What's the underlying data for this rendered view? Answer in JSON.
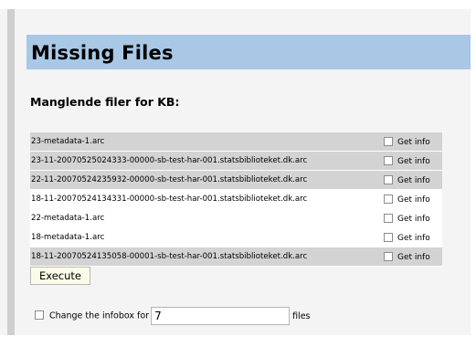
{
  "page": {
    "title": "Missing Files",
    "subtitle": "Manglende filer for KB:"
  },
  "files": [
    {
      "name": "23-metadata-1.arc",
      "option_label": "Get info",
      "row_shade": "dark"
    },
    {
      "name": "23-11-20070525024333-00000-sb-test-har-001.statsbiblioteket.dk.arc",
      "option_label": "Get info",
      "row_shade": "dark"
    },
    {
      "name": "22-11-20070524235932-00000-sb-test-har-001.statsbiblioteket.dk.arc",
      "option_label": "Get info",
      "row_shade": "dark"
    },
    {
      "name": "18-11-20070524134331-00000-sb-test-har-001.statsbiblioteket.dk.arc",
      "option_label": "Get info",
      "row_shade": "light"
    },
    {
      "name": "22-metadata-1.arc",
      "option_label": "Get info",
      "row_shade": "light"
    },
    {
      "name": "18-metadata-1.arc",
      "option_label": "Get info",
      "row_shade": "light"
    },
    {
      "name": "18-11-20070524135058-00001-sb-test-har-001.statsbiblioteket.dk.arc",
      "option_label": "Get info",
      "row_shade": "dark"
    }
  ],
  "actions": {
    "execute_label": "Execute"
  },
  "infobox": {
    "prefix_label": "Change the infobox for",
    "count_value": "7",
    "suffix_label": "files"
  },
  "colors": {
    "title_bar": "#a8c8e6",
    "row_dark": "#d3d3d3",
    "row_light": "#ffffff",
    "button_bg": "#fbfbe8"
  }
}
